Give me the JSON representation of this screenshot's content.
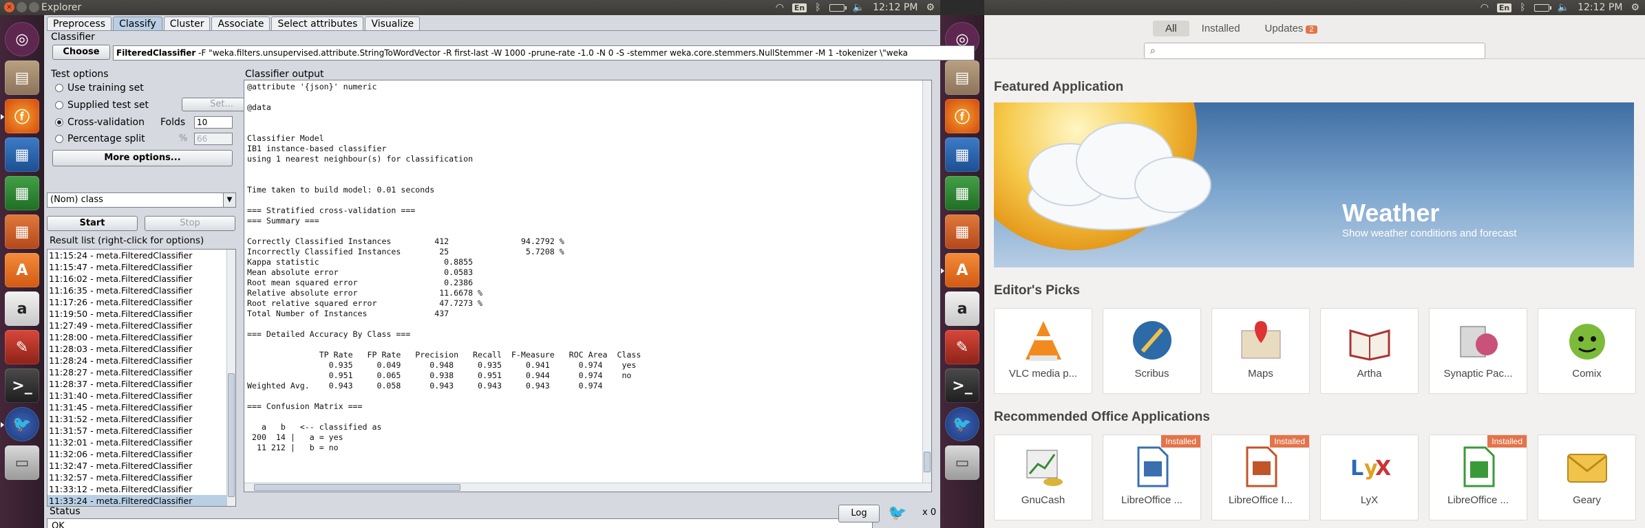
{
  "panel_left": {
    "window_title": "Explorer"
  },
  "tray": {
    "keyboard": "En",
    "time_left": "12:12 PM",
    "time_right": "12:12 PM"
  },
  "launcher": {
    "icons": [
      "ubuntu-dash-icon",
      "files-icon",
      "firefox-icon",
      "writer-icon",
      "calc-icon",
      "impress-icon",
      "software-center-icon",
      "amazon-icon",
      "system-settings-icon",
      "terminal-icon",
      "weka-icon",
      "drive-icon"
    ]
  },
  "weka": {
    "tabs": [
      "Preprocess",
      "Classify",
      "Cluster",
      "Associate",
      "Select attributes",
      "Visualize"
    ],
    "classifier_label": "Classifier",
    "choose_label": "Choose",
    "classifier_name": "FilteredClassifier",
    "classifier_args": " -F \"weka.filters.unsupervised.attribute.StringToWordVector -R first-last -W 1000 -prune-rate -1.0 -N 0 -S -stemmer weka.core.stemmers.NullStemmer -M 1 -tokenizer \\\"weka",
    "test_options_label": "Test options",
    "use_training_set": "Use training set",
    "supplied_test_set": "Supplied test set",
    "set_label": "Set...",
    "cross_validation": "Cross-validation",
    "folds_label": "Folds",
    "folds_value": "10",
    "percentage_split": "Percentage split",
    "percent_sign": "%",
    "percent_value": "66",
    "more_options": "More options...",
    "class_select": "(Nom) class",
    "start_label": "Start",
    "stop_label": "Stop",
    "result_list_label": "Result list (right-click for options)",
    "results": [
      "11:15:24 - meta.FilteredClassifier",
      "11:15:47 - meta.FilteredClassifier",
      "11:16:02 - meta.FilteredClassifier",
      "11:16:35 - meta.FilteredClassifier",
      "11:17:26 - meta.FilteredClassifier",
      "11:19:50 - meta.FilteredClassifier",
      "11:27:49 - meta.FilteredClassifier",
      "11:28:00 - meta.FilteredClassifier",
      "11:28:03 - meta.FilteredClassifier",
      "11:28:24 - meta.FilteredClassifier",
      "11:28:27 - meta.FilteredClassifier",
      "11:28:37 - meta.FilteredClassifier",
      "11:31:40 - meta.FilteredClassifier",
      "11:31:45 - meta.FilteredClassifier",
      "11:31:52 - meta.FilteredClassifier",
      "11:31:57 - meta.FilteredClassifier",
      "11:32:01 - meta.FilteredClassifier",
      "11:32:06 - meta.FilteredClassifier",
      "11:32:47 - meta.FilteredClassifier",
      "11:32:57 - meta.FilteredClassifier",
      "11:33:12 - meta.FilteredClassifier",
      "11:33:24 - meta.FilteredClassifier"
    ],
    "output_label": "Classifier output",
    "output_text": "@attribute '{json}' numeric\n\n@data\n\n\nClassifier Model\nIB1 instance-based classifier\nusing 1 nearest neighbour(s) for classification\n\n\nTime taken to build model: 0.01 seconds\n\n=== Stratified cross-validation ===\n=== Summary ===\n\nCorrectly Classified Instances         412               94.2792 %\nIncorrectly Classified Instances        25                5.7208 %\nKappa statistic                          0.8855\nMean absolute error                      0.0583\nRoot mean squared error                  0.2386\nRelative absolute error                 11.6678 %\nRoot relative squared error             47.7273 %\nTotal Number of Instances              437     \n\n=== Detailed Accuracy By Class ===\n\n               TP Rate   FP Rate   Precision   Recall  F-Measure   ROC Area  Class\n                 0.935     0.049      0.948     0.935     0.941      0.974    yes\n                 0.951     0.065      0.938     0.951     0.944      0.974    no\nWeighted Avg.    0.943     0.058      0.943     0.943     0.943      0.974\n\n=== Confusion Matrix ===\n\n   a   b   <-- classified as\n 200  14 |   a = yes\n  11 212 |   b = no",
    "status_label": "Status",
    "status_text": "OK",
    "log_label": "Log",
    "task_count": "x 0"
  },
  "software_center": {
    "tabs": [
      "All",
      "Installed",
      "Updates"
    ],
    "updates_count": "2",
    "featured_heading": "Featured Application",
    "banner_title": "Weather",
    "banner_subtitle": "Show weather conditions and forecast",
    "editors_heading": "Editor's Picks",
    "editors": [
      {
        "name": "VLC media p...",
        "icon": "vlc-icon"
      },
      {
        "name": "Scribus",
        "icon": "scribus-icon"
      },
      {
        "name": "Maps",
        "icon": "maps-icon"
      },
      {
        "name": "Artha",
        "icon": "artha-icon"
      },
      {
        "name": "Synaptic Pac...",
        "icon": "synaptic-icon"
      },
      {
        "name": "Comix",
        "icon": "comix-icon"
      }
    ],
    "office_heading": "Recommended Office Applications",
    "office": [
      {
        "name": "GnuCash",
        "icon": "gnucash-icon",
        "installed": ""
      },
      {
        "name": "LibreOffice ...",
        "icon": "libreoffice-draw-icon",
        "installed": "Installed"
      },
      {
        "name": "LibreOffice I...",
        "icon": "libreoffice-impress-icon",
        "installed": "Installed"
      },
      {
        "name": "LyX",
        "icon": "lyx-icon",
        "installed": ""
      },
      {
        "name": "LibreOffice ...",
        "icon": "libreoffice-calc-icon",
        "installed": "Installed"
      },
      {
        "name": "Geary",
        "icon": "geary-icon",
        "installed": ""
      }
    ]
  }
}
